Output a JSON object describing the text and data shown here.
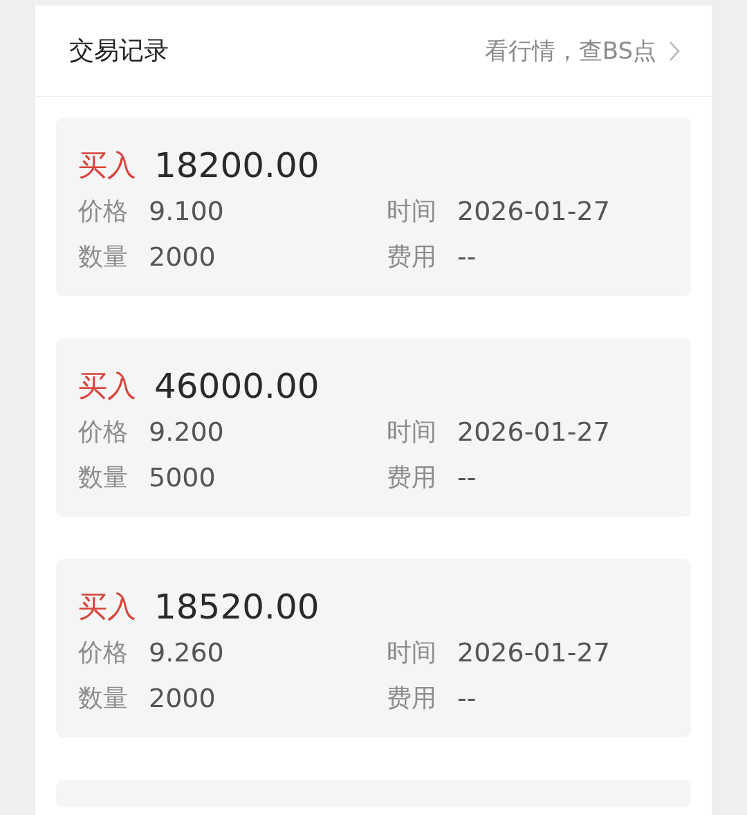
{
  "header": {
    "title": "交易记录",
    "link": "看行情，查BS点"
  },
  "trades": [
    {
      "side": "买入",
      "kind": "buy",
      "amount": "18200.00",
      "price": {
        "label": "价格",
        "value": "9.100"
      },
      "time": {
        "label": "时间",
        "value": "2026-01-27"
      },
      "quantity": {
        "label": "数量",
        "value": "2000"
      },
      "fee": {
        "label": "费用",
        "value": "--"
      }
    },
    {
      "side": "买入",
      "kind": "buy",
      "amount": "46000.00",
      "price": {
        "label": "价格",
        "value": "9.200"
      },
      "time": {
        "label": "时间",
        "value": "2026-01-27"
      },
      "quantity": {
        "label": "数量",
        "value": "5000"
      },
      "fee": {
        "label": "费用",
        "value": "--"
      }
    },
    {
      "side": "买入",
      "kind": "buy",
      "amount": "18520.00",
      "price": {
        "label": "价格",
        "value": "9.260"
      },
      "time": {
        "label": "时间",
        "value": "2026-01-27"
      },
      "quantity": {
        "label": "数量",
        "value": "2000"
      },
      "fee": {
        "label": "费用",
        "value": "--"
      }
    }
  ],
  "more_below": true
}
